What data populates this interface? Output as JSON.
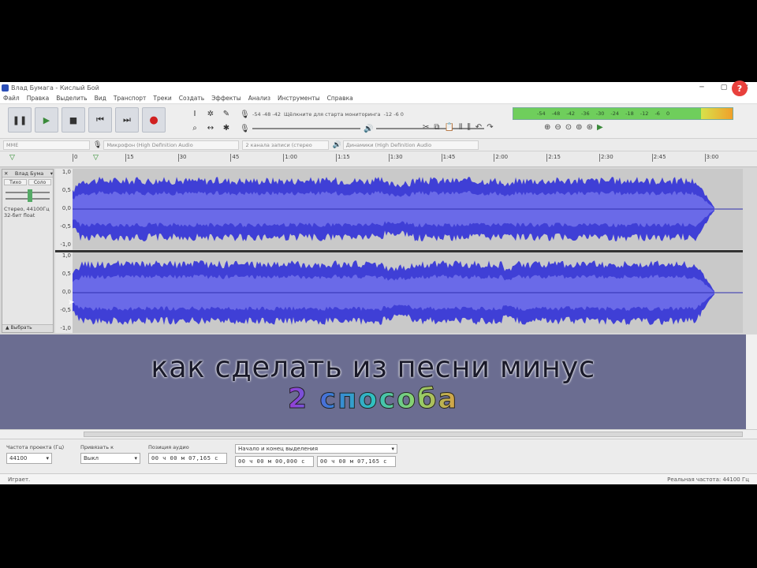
{
  "window": {
    "title": "Влад Бумага - Кислый Бой",
    "controls": [
      "─",
      "▢",
      "✕"
    ],
    "help_label": "?"
  },
  "menu": [
    "Файл",
    "Правка",
    "Выделить",
    "Вид",
    "Транспорт",
    "Треки",
    "Создать",
    "Эффекты",
    "Анализ",
    "Инструменты",
    "Справка"
  ],
  "transport": {
    "pause": "❚❚",
    "play": "▶",
    "stop": "■",
    "skip_start": "⏮",
    "skip_end": "⏭",
    "record": "●"
  },
  "mixer": {
    "playback_scale": "-54  -48  -42",
    "playback_hint": "Щёлкните для старта мониторинга",
    "playback_scale_end": "-12  -6  0",
    "meter_scale": "-54  -48  -42  -36  -30  -24  -18  -12  -6  0"
  },
  "device": {
    "host": "MME",
    "recording": "Микрофон (High Definition Audio",
    "channels": "2 канала записи (стерео",
    "playback": "Динамики (High Definition Audio"
  },
  "timeline": {
    "ticks": [
      "0",
      "15",
      "30",
      "45",
      "1:00",
      "1:15",
      "1:30",
      "1:45",
      "2:00",
      "2:15",
      "2:30",
      "2:45",
      "3:00"
    ]
  },
  "track": {
    "name": "Влад Бума",
    "mute": "Тихо",
    "solo": "Соло",
    "info_line1": "Стерео, 44100Гц",
    "info_line2": "32-бит float",
    "collapse": "Выбрать",
    "scale": [
      "1,0",
      "0,5",
      "0,0",
      "-0,5",
      "-1,0"
    ],
    "wave_color": "#3f3fd6"
  },
  "overlay": {
    "headline": "как сделать из песни минус",
    "subline": "2 способа"
  },
  "selection": {
    "rate_label": "Частота проекта (Гц)",
    "rate_value": "44100",
    "snap_label": "Привязать к",
    "snap_value": "Выкл",
    "position_label": "Позиция аудио",
    "position_value": "00 ч 00 м 07,165 с",
    "range_label": "Начало и конец выделения",
    "range_start": "00 ч 00 м 00,000 с",
    "range_end": "00 ч 00 м 07,165 с"
  },
  "status": {
    "left": "Играет.",
    "right": "Реальная частота: 44100 Гц"
  }
}
